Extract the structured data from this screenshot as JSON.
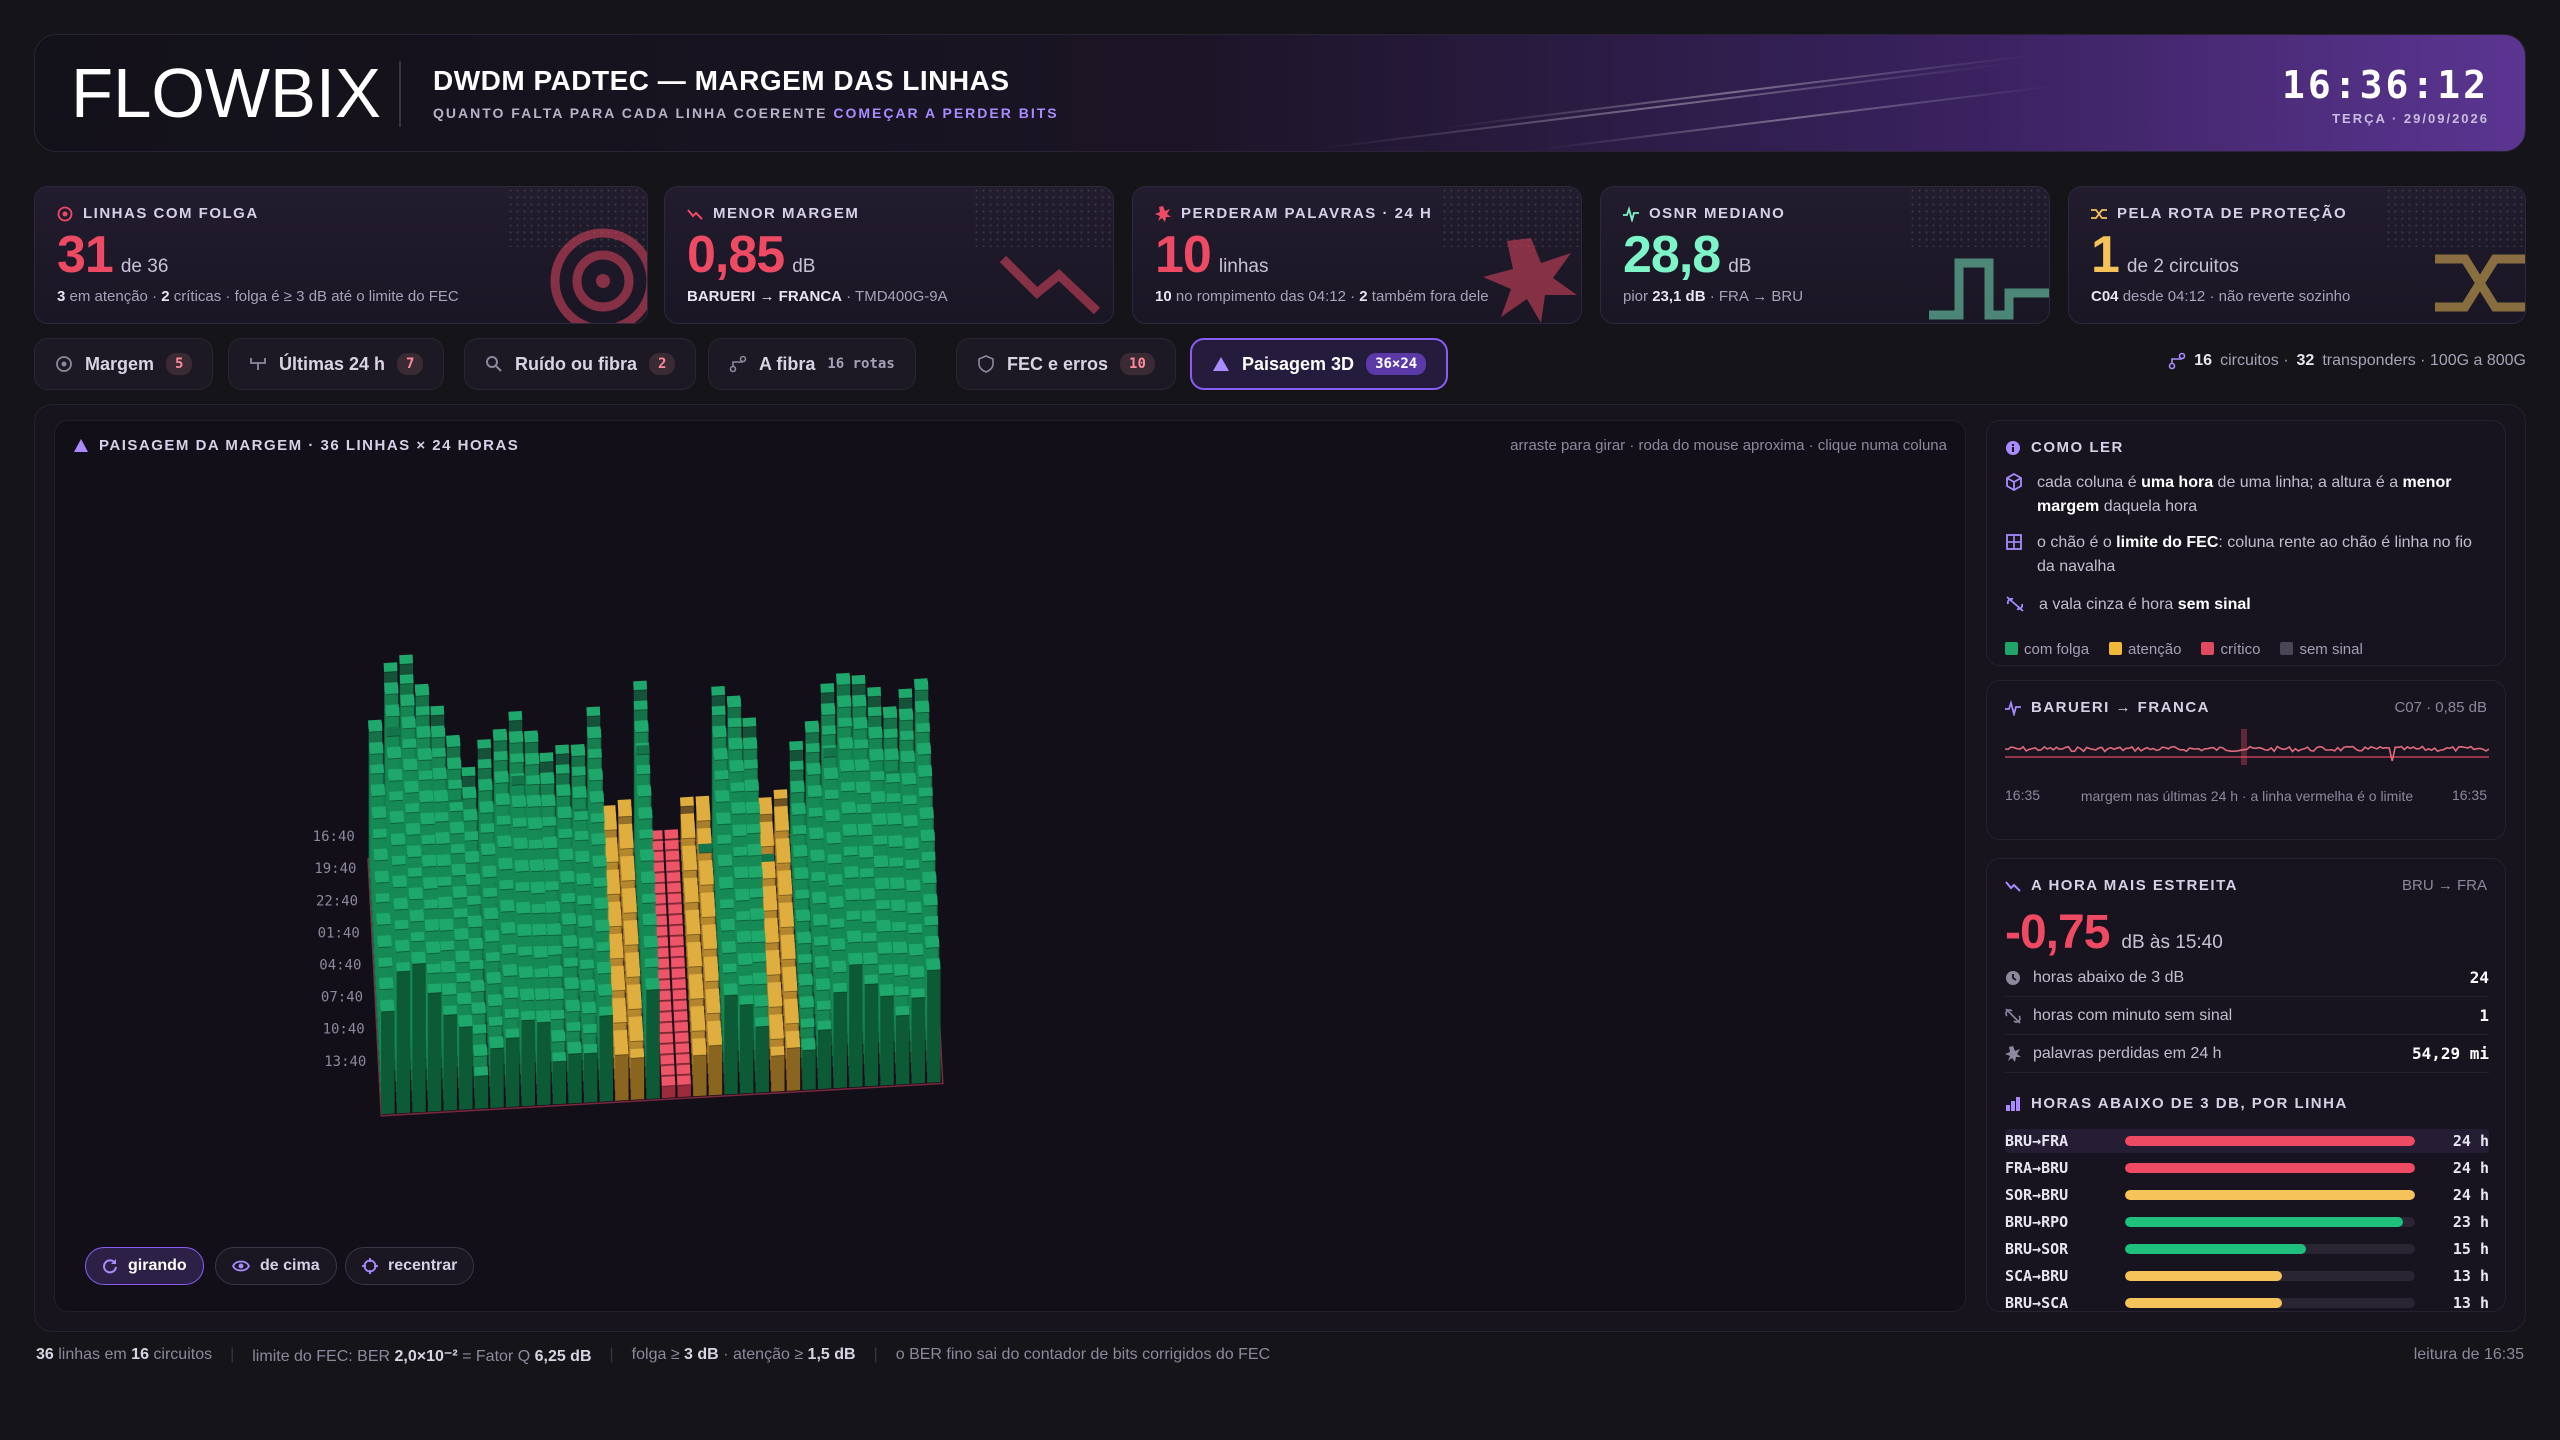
{
  "header": {
    "logo_text": "FLOWBIX",
    "title": "DWDM PADTEC — MARGEM DAS LINHAS",
    "subtitle_pre": "QUANTO FALTA PARA CADA LINHA COERENTE ",
    "subtitle_accent": "COMEÇAR A PERDER BITS",
    "clock": "16:36:12",
    "date": "TERÇA · 29/09/2026"
  },
  "kpis": [
    {
      "label": "LINHAS COM FOLGA",
      "icon": "target-icon",
      "value": "31",
      "unit": "de 36",
      "foot_a": "3",
      "foot_b": " em atenção · ",
      "foot_c": "2",
      "foot_d": " críticas · folga é ≥ 3 dB até o limite do FEC"
    },
    {
      "label": "MENOR MARGEM",
      "icon": "trend-down-icon",
      "value": "0,85",
      "unit": "dB",
      "foot_a": "BARUERI → FRANCA",
      "foot_b": " · TMD400G-9A",
      "foot_c": "",
      "foot_d": ""
    },
    {
      "label": "PERDERAM PALAVRAS · 24 H",
      "icon": "burst-icon",
      "value": "10",
      "unit": "linhas",
      "foot_a": "10",
      "foot_b": " no rompimento das 04:12 · ",
      "foot_c": "2",
      "foot_d": " também fora dele"
    },
    {
      "label": "OSNR MEDIANO",
      "icon": "pulse-icon",
      "value": "28,8",
      "unit": "dB",
      "foot_a": "",
      "foot_b": "pior ",
      "foot_c": "23,1 dB",
      "foot_d": " · FRA → BRU"
    },
    {
      "label": "PELA ROTA DE PROTEÇÃO",
      "icon": "shuffle-icon",
      "value": "1",
      "unit": "de 2 circuitos",
      "foot_a": "C04",
      "foot_b": " desde 04:12 · não reverte sozinho",
      "foot_c": "",
      "foot_d": ""
    }
  ],
  "tabs": [
    {
      "label": "Margem",
      "badge": "5"
    },
    {
      "label": "Últimas 24 h",
      "badge": "7"
    },
    {
      "label": "Ruído ou fibra",
      "badge": "2"
    },
    {
      "label": "A fibra",
      "badge": "16 rotas"
    },
    {
      "label": "FEC e erros",
      "badge": "10"
    },
    {
      "label": "Paisagem 3D",
      "badge": "36×24"
    }
  ],
  "tabs_right": {
    "n1": "16",
    "t1": "circuitos ·",
    "n2": "32",
    "t2": "transponders · 100G a 800G"
  },
  "viz": {
    "title": "PAISAGEM DA MARGEM · 36 LINHAS × 24 HORAS",
    "hint": "arraste para girar · roda do mouse aproxima · clique numa coluna",
    "time_labels": [
      "16:40",
      "19:40",
      "22:40",
      "01:40",
      "04:40",
      "07:40",
      "10:40",
      "13:40"
    ],
    "buttons": [
      "girando",
      "de cima",
      "recentrar"
    ]
  },
  "help": {
    "title": "COMO LER",
    "r1a": "cada coluna é ",
    "r1b": "uma hora",
    "r1c": " de uma linha; a altura é a ",
    "r1d": "menor margem",
    "r1e": " daquela hora",
    "r2a": "o chão é o ",
    "r2b": "limite do FEC",
    "r2c": ": coluna rente ao chão é linha no fio da navalha",
    "r3a": "a vala cinza é hora ",
    "r3b": "sem sinal",
    "legend": [
      "com folga",
      "atenção",
      "crítico",
      "sem sinal"
    ]
  },
  "spark": {
    "title": "BARUERI → FRANCA",
    "right": "C07 · 0,85 dB",
    "t_left": "16:35",
    "caption": "margem nas últimas 24 h · a linha vermelha é o limite",
    "t_right": "16:35"
  },
  "narrow": {
    "title": "A HORA MAIS ESTREITA",
    "right": "BRU → FRA",
    "value": "-0,75",
    "unit": "dB às 15:40",
    "stats": [
      {
        "label": "horas abaixo de 3 dB",
        "value": "24"
      },
      {
        "label": "horas com minuto sem sinal",
        "value": "1"
      },
      {
        "label": "palavras perdidas em 24 h",
        "value": "54,29 mi"
      }
    ],
    "bars_title": "HORAS ABAIXO DE 3 DB, POR LINHA",
    "bars": [
      {
        "label": "BRU→FRA",
        "hours": 24,
        "value": "24 h",
        "color": "#ef4a64"
      },
      {
        "label": "FRA→BRU",
        "hours": 24,
        "value": "24 h",
        "color": "#ef4a64"
      },
      {
        "label": "SOR→BRU",
        "hours": 24,
        "value": "24 h",
        "color": "#f5c35a"
      },
      {
        "label": "BRU→RPO",
        "hours": 23,
        "value": "23 h",
        "color": "#1fbf7e"
      },
      {
        "label": "BRU→SOR",
        "hours": 15,
        "value": "15 h",
        "color": "#1fbf7e"
      },
      {
        "label": "SCA→BRU",
        "hours": 13,
        "value": "13 h",
        "color": "#f5c35a"
      },
      {
        "label": "BRU→SCA",
        "hours": 13,
        "value": "13 h",
        "color": "#f5c35a"
      }
    ]
  },
  "footer": {
    "a1": "36",
    "a2": " linhas em ",
    "a3": "16",
    "a4": " circuitos",
    "b1": "limite do FEC: BER ",
    "b2": "2,0×10⁻²",
    "b3": " = Fator Q ",
    "b4": "6,25 dB",
    "c1": "folga ≥ ",
    "c2": "3 dB",
    "c3": " · atenção ≥ ",
    "c4": "1,5 dB",
    "d": "o BER fino sai do contador de bits corrigidos do FEC",
    "right": "leitura de 16:35"
  },
  "colors": {
    "green": "#1fa56a",
    "yellow": "#d9a93e",
    "red": "#d84a5c",
    "accent": "#8a5cf6"
  }
}
